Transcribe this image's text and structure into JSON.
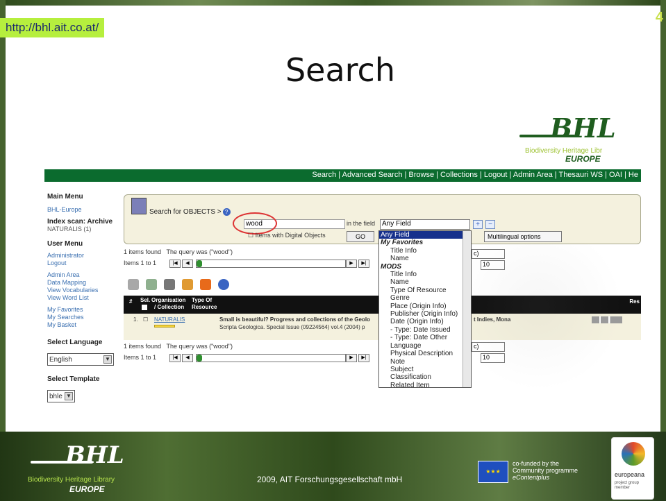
{
  "slide": {
    "url": "http://bhl.ait.co.at/",
    "page_number": "4",
    "title": "Search",
    "copyright": "2009, AIT Forschungsgesellschaft mbH",
    "eu_text_1": "co-funded by the",
    "eu_text_2": "Community programme",
    "eu_text_3": "eContentplus",
    "europeana_name": "europeana",
    "europeana_sub_1": "project group",
    "europeana_sub_2": "member"
  },
  "logo": {
    "mark": "BHL",
    "subtitle": "Biodiversity Heritage Libr",
    "europe": "EUROPE"
  },
  "footer_logo": {
    "mark": "BHL",
    "subtitle": "Biodiversity Heritage Library",
    "europe": "EUROPE"
  },
  "topnav": {
    "text": "Search | Advanced Search | Browse | Collections | Logout | Admin Area | Thesauri WS | OAI | He"
  },
  "sidebar": {
    "main_menu": "Main Menu",
    "bhl_europe": "BHL-Europe",
    "index_scan": "Index scan: Archive",
    "naturalis": "NATURALIS (1)",
    "user_menu": "User Menu",
    "administrator": "Administrator",
    "logout": "Logout",
    "admin_area": "Admin Area",
    "data_mapping": "Data Mapping",
    "view_vocab": "View Vocabularies",
    "view_wordlist": "View Word List",
    "my_favorites": "My Favorites",
    "my_searches": "My Searches",
    "my_basket": "My Basket",
    "select_language": "Select Language",
    "language_value": "English",
    "select_template": "Select Template",
    "template_value": "bhle"
  },
  "search": {
    "title": "Search for OBJECTS >",
    "query": "wood",
    "in_the_field": "in the field",
    "field_value": "Any Field",
    "digital_objects": "Items with Digital Objects",
    "go": "GO",
    "multilingual": "Multilingual options"
  },
  "results": {
    "found_top": "1 items found",
    "query_was": "The query was (\"wood\")",
    "items_range": "Items 1 to 1",
    "sort_suffix": "c)",
    "per_page": "10",
    "found_bottom": "1 items found",
    "query_was_bottom": "The query was (\"wood\")",
    "items_range_bottom": "Items 1 to 1",
    "sort_suffix_bottom": "c)",
    "per_page_bottom": "10"
  },
  "table": {
    "col_num": "#",
    "col_sel": "Sel.",
    "col_org_1": "Organisation",
    "col_org_2": "/ Collection",
    "col_type_1": "Type Of",
    "col_type_2": "Resource",
    "col_res": "Res",
    "row_num": "1.",
    "row_org": "NATURALIS",
    "row_title": "Small is beautiful? Progress and collections of the Geolo",
    "row_title_right": "t Indies, Mona",
    "row_source": "Scripta Geologica. Special Issue (09224564) vol.4 (2004) p"
  },
  "dropdown": {
    "items": [
      {
        "label": "Any Field",
        "kind": "selected"
      },
      {
        "label": "My Favorites",
        "kind": "group"
      },
      {
        "label": "Title Info",
        "kind": "item"
      },
      {
        "label": "Name",
        "kind": "item"
      },
      {
        "label": "MODS",
        "kind": "group"
      },
      {
        "label": "Title Info",
        "kind": "item"
      },
      {
        "label": "Name",
        "kind": "item"
      },
      {
        "label": "Type Of Resource",
        "kind": "item"
      },
      {
        "label": "Genre",
        "kind": "item"
      },
      {
        "label": "Place (Origin Info)",
        "kind": "item"
      },
      {
        "label": "Publisher (Origin Info)",
        "kind": "item"
      },
      {
        "label": "Date (Origin Info)",
        "kind": "item"
      },
      {
        "label": "- Type: Date Issued",
        "kind": "item"
      },
      {
        "label": "- Type: Date Other",
        "kind": "item"
      },
      {
        "label": "Language",
        "kind": "item"
      },
      {
        "label": "Physical Description",
        "kind": "item"
      },
      {
        "label": "Note",
        "kind": "item"
      },
      {
        "label": "Subject",
        "kind": "item"
      },
      {
        "label": "Classification",
        "kind": "item"
      },
      {
        "label": "Related Item",
        "kind": "item"
      }
    ]
  },
  "colors": {
    "brand_green": "#0b6b2e",
    "url_badge": "#b6ef3e",
    "dropdown_selected": "#16308c"
  }
}
